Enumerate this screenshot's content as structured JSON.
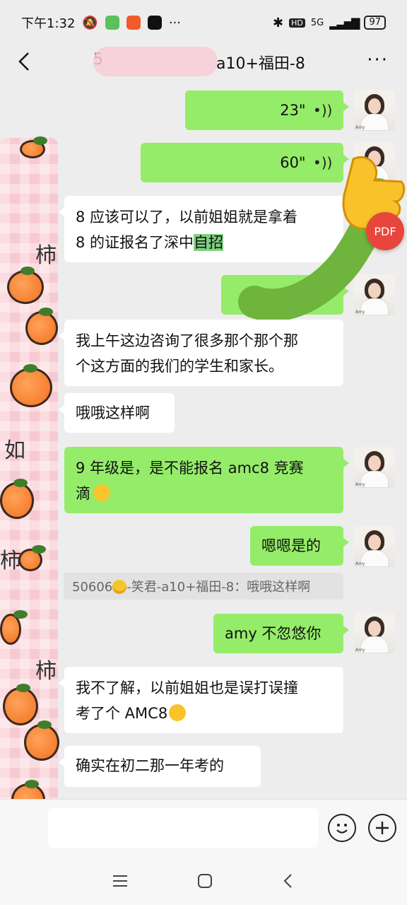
{
  "status_bar": {
    "time": "下午1:32",
    "signal_label": "5G",
    "hd_label": "HD",
    "battery": "97",
    "more": "···"
  },
  "header": {
    "title_prefix": "5",
    "title_suffix": "a10+福田-8",
    "more": "···"
  },
  "colors": {
    "my_bubble": "#95ec69",
    "their_bubble": "#ffffff",
    "highlight": "#7ed07e",
    "pdf_badge": "#e8463c"
  },
  "messages": [
    {
      "sender": "me",
      "type": "voice",
      "duration": "23\""
    },
    {
      "sender": "me",
      "type": "voice",
      "duration": "60\""
    },
    {
      "sender": "them",
      "text_line1": "8 应该可以了，以前姐姐就是拿着",
      "text_line2_pre": "8 的证报名了深中",
      "text_line2_highlight": "自招"
    },
    {
      "sender": "me",
      "type": "voice",
      "duration": ""
    },
    {
      "sender": "them",
      "text_line1": "我上午这边咨询了很多那个那个那",
      "text_line2": "个这方面的我们的学生和家长。"
    },
    {
      "sender": "them",
      "text": "哦哦这样啊"
    },
    {
      "sender": "me",
      "text_line1": "9 年级是，是不能报名 amc8 竞赛",
      "text_line2": "滴"
    },
    {
      "sender": "me",
      "text": "嗯嗯是的"
    },
    {
      "sender": "me",
      "text": "amy 不忽悠你"
    },
    {
      "sender": "them",
      "text_line1": "我不了解，以前姐姐也是误打误撞",
      "text_line2": "考了个 AMC8"
    },
    {
      "sender": "them",
      "text": "确实在初二那一年考的"
    }
  ],
  "quote": {
    "prefix": "50606",
    "suffix": "-笑君-a10+福田-8：哦哦这样啊"
  },
  "avatar_label": "Amy",
  "pdf_label": "PDF",
  "input": {
    "placeholder": ""
  },
  "icons": [
    "back-icon",
    "more-icon",
    "voice-icon",
    "emoji-icon",
    "plus-icon",
    "menu-icon",
    "home-icon",
    "nav-back-icon"
  ]
}
